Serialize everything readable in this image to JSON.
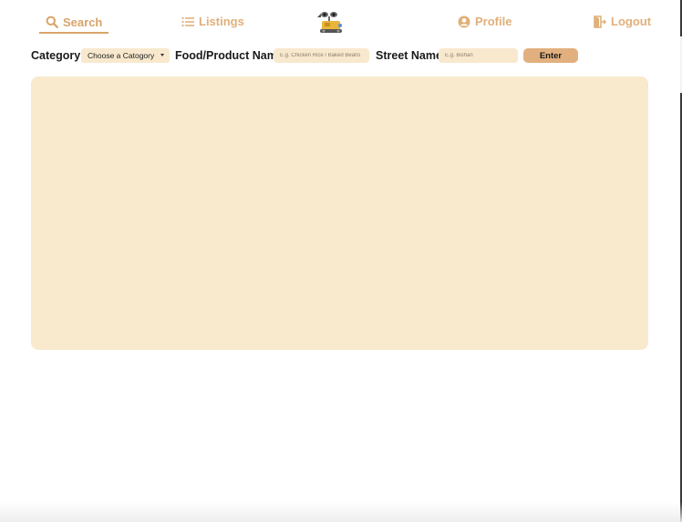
{
  "nav": {
    "search_label": "Search",
    "listings_label": "Listings",
    "profile_label": "Profile",
    "logout_label": "Logout",
    "active": "search",
    "accent_color": "#e0b07a"
  },
  "filters": {
    "category_label": "Category",
    "category_selected": "Choose a Catogory",
    "food_label": "Food/Product Name",
    "food_placeholder": "E.g. Chicken Rice / Baked Beans",
    "street_label": "Street Name",
    "street_placeholder": "E.g. Bishan",
    "enter_label": "Enter"
  },
  "colors": {
    "panel_bg": "#f9e9cd",
    "button_bg": "#e2b07f"
  }
}
